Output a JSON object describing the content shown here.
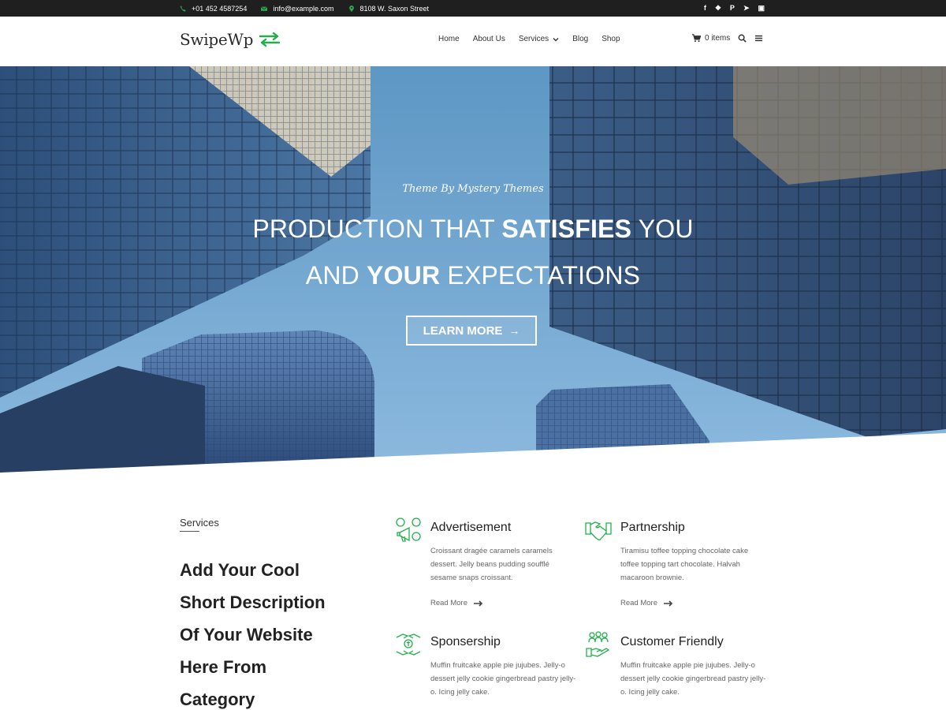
{
  "colors": {
    "accent": "#23b04c",
    "topbar_bg": "#1f1f1f",
    "heading": "#222222"
  },
  "topbar": {
    "phone": "+01 452 4587254",
    "email": "info@example.com",
    "address": "8108 W. Saxon Street",
    "social_icons": [
      "facebook-icon",
      "twitter-icon",
      "pinterest-icon",
      "telegram-icon",
      "instagram-icon"
    ]
  },
  "header": {
    "logo_text": "SwipeWp",
    "nav": [
      "Home",
      "About Us",
      "Services",
      "Blog",
      "Shop"
    ],
    "cart_label": "0 items"
  },
  "hero": {
    "tagline": "Theme By Mystery Themes",
    "line1_a": "PRODUCTION THAT ",
    "line1_b": "SATISFIES",
    "line1_c": " YOU",
    "line2_a": "AND ",
    "line2_b": "YOUR",
    "line2_c": " EXPECTATIONS",
    "button_label": "LEARN MORE",
    "button_arrow": "→"
  },
  "services": {
    "section_label": "Services",
    "description_lines": [
      "Add Your Cool",
      "Short Description",
      "Of Your Website",
      "Here From",
      "Category"
    ],
    "cards": [
      {
        "icon": "advertisement-icon",
        "title": "Advertisement",
        "text": "Croissant dragée caramels caramels dessert. Jelly beans pudding soufflé sesame snaps croissant.",
        "link": "Read More"
      },
      {
        "icon": "handshake-icon",
        "title": "Partnership",
        "text": "Tiramisu toffee topping chocolate cake toffee topping tart chocolate. Halvah macaroon brownie.",
        "link": "Read More"
      },
      {
        "icon": "sponsorship-icon",
        "title": "Sponsership",
        "text": "Muffin fruitcake apple pie jujubes. Jelly-o dessert jelly cookie gingerbread pastry jelly-o. Icing jelly cake."
      },
      {
        "icon": "customer-icon",
        "title": "Customer Friendly",
        "text": "Muffin fruitcake apple pie jujubes. Jelly-o dessert jelly cookie gingerbread pastry jelly-o. Icing jelly cake."
      }
    ]
  }
}
